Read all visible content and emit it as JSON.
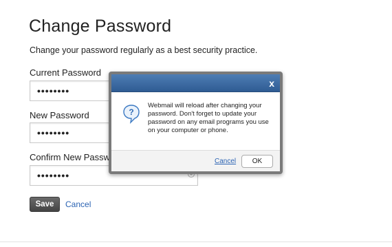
{
  "page": {
    "title": "Change Password",
    "subtitle": "Change your password regularly as a best security practice."
  },
  "form": {
    "current_label": "Current Password",
    "current_value": "••••••••",
    "new_label": "New Password",
    "new_value": "••••••••",
    "confirm_label": "Confirm New Password",
    "confirm_value": "••••••••",
    "save_label": "Save",
    "cancel_label": "Cancel"
  },
  "dialog": {
    "close_glyph": "x",
    "icon": "question-icon",
    "message": "Webmail will reload after changing your password. Don't forget to update your password on any email programs you use on your computer or phone.",
    "cancel_label": "Cancel",
    "ok_label": "OK"
  },
  "colors": {
    "dialog_header": "#3b6aa2",
    "link": "#2b63b3",
    "save_button": "#555555"
  }
}
